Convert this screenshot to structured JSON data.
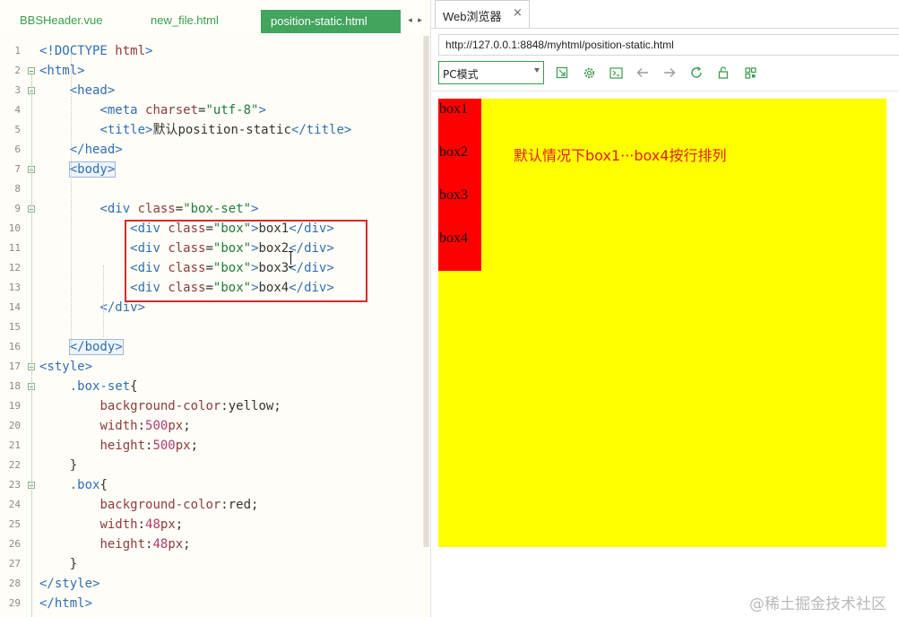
{
  "editor": {
    "tabs": [
      {
        "label": "BBSHeader.vue",
        "active": false
      },
      {
        "label": "new_file.html",
        "active": false
      },
      {
        "label": "position-static.html",
        "active": true
      }
    ],
    "tab_scroll": {
      "left": "◂",
      "right": "▸"
    },
    "lines": [
      {
        "n": "1",
        "tokens": [
          [
            "tg",
            "<!DOCTYPE "
          ],
          [
            "at",
            "html"
          ],
          [
            "tg",
            ">"
          ]
        ]
      },
      {
        "n": "2",
        "tokens": [
          [
            "tg",
            "<html>"
          ]
        ]
      },
      {
        "n": "3",
        "tokens": [
          [
            "tx",
            "    "
          ],
          [
            "tg",
            "<head>"
          ]
        ]
      },
      {
        "n": "4",
        "tokens": [
          [
            "tx",
            "        "
          ],
          [
            "tg",
            "<meta "
          ],
          [
            "at",
            "charset"
          ],
          [
            "tx",
            "="
          ],
          [
            "st",
            "\"utf-8\""
          ],
          [
            "tg",
            ">"
          ]
        ]
      },
      {
        "n": "5",
        "tokens": [
          [
            "tx",
            "        "
          ],
          [
            "tg",
            "<title>"
          ],
          [
            "tx",
            "默认position-static"
          ],
          [
            "tg",
            "</title>"
          ]
        ]
      },
      {
        "n": "6",
        "tokens": [
          [
            "tx",
            "    "
          ],
          [
            "tg",
            "</head>"
          ]
        ]
      },
      {
        "n": "7",
        "tokens": [
          [
            "tx",
            "    "
          ],
          [
            "tg",
            "<body>"
          ]
        ]
      },
      {
        "n": "8",
        "tokens": []
      },
      {
        "n": "9",
        "tokens": [
          [
            "tx",
            "        "
          ],
          [
            "tg",
            "<div "
          ],
          [
            "at",
            "class"
          ],
          [
            "tx",
            "="
          ],
          [
            "st",
            "\"box-set\""
          ],
          [
            "tg",
            ">"
          ]
        ]
      },
      {
        "n": "10",
        "tokens": [
          [
            "tx",
            "            "
          ],
          [
            "tg",
            "<div "
          ],
          [
            "at",
            "class"
          ],
          [
            "tx",
            "="
          ],
          [
            "st",
            "\"box\""
          ],
          [
            "tg",
            ">"
          ],
          [
            "tx",
            "box1"
          ],
          [
            "tg",
            "</div>"
          ]
        ]
      },
      {
        "n": "11",
        "tokens": [
          [
            "tx",
            "            "
          ],
          [
            "tg",
            "<div "
          ],
          [
            "at",
            "class"
          ],
          [
            "tx",
            "="
          ],
          [
            "st",
            "\"box\""
          ],
          [
            "tg",
            ">"
          ],
          [
            "tx",
            "box2"
          ],
          [
            "tg",
            "</div>"
          ]
        ]
      },
      {
        "n": "12",
        "tokens": [
          [
            "tx",
            "            "
          ],
          [
            "tg",
            "<div "
          ],
          [
            "at",
            "class"
          ],
          [
            "tx",
            "="
          ],
          [
            "st",
            "\"box\""
          ],
          [
            "tg",
            ">"
          ],
          [
            "tx",
            "box3"
          ],
          [
            "tg",
            "</div>"
          ]
        ]
      },
      {
        "n": "13",
        "tokens": [
          [
            "tx",
            "            "
          ],
          [
            "tg",
            "<div "
          ],
          [
            "at",
            "class"
          ],
          [
            "tx",
            "="
          ],
          [
            "st",
            "\"box\""
          ],
          [
            "tg",
            ">"
          ],
          [
            "tx",
            "box4"
          ],
          [
            "tg",
            "</div>"
          ]
        ]
      },
      {
        "n": "14",
        "tokens": [
          [
            "tx",
            "        "
          ],
          [
            "tg",
            "</div>"
          ]
        ]
      },
      {
        "n": "15",
        "tokens": []
      },
      {
        "n": "16",
        "tokens": [
          [
            "tx",
            "    "
          ],
          [
            "tg",
            "</body>"
          ]
        ]
      },
      {
        "n": "17",
        "tokens": [
          [
            "tg",
            "<style>"
          ]
        ]
      },
      {
        "n": "18",
        "tokens": [
          [
            "tx",
            "    "
          ],
          [
            "sel",
            ".box-set"
          ],
          [
            "tx",
            "{"
          ]
        ]
      },
      {
        "n": "19",
        "tokens": [
          [
            "tx",
            "        "
          ],
          [
            "pr",
            "background-color"
          ],
          [
            "tx",
            ":yellow;"
          ]
        ]
      },
      {
        "n": "20",
        "tokens": [
          [
            "tx",
            "        "
          ],
          [
            "pr",
            "width"
          ],
          [
            "tx",
            ":"
          ],
          [
            "nu",
            "500"
          ],
          [
            "un",
            "px"
          ],
          [
            "tx",
            ";"
          ]
        ]
      },
      {
        "n": "21",
        "tokens": [
          [
            "tx",
            "        "
          ],
          [
            "pr",
            "height"
          ],
          [
            "tx",
            ":"
          ],
          [
            "nu",
            "500"
          ],
          [
            "un",
            "px"
          ],
          [
            "tx",
            ";"
          ]
        ]
      },
      {
        "n": "22",
        "tokens": [
          [
            "tx",
            "    }"
          ]
        ]
      },
      {
        "n": "23",
        "tokens": [
          [
            "tx",
            "    "
          ],
          [
            "sel",
            ".box"
          ],
          [
            "tx",
            "{"
          ]
        ]
      },
      {
        "n": "24",
        "tokens": [
          [
            "tx",
            "        "
          ],
          [
            "pr",
            "background-color"
          ],
          [
            "tx",
            ":red;"
          ]
        ]
      },
      {
        "n": "25",
        "tokens": [
          [
            "tx",
            "        "
          ],
          [
            "pr",
            "width"
          ],
          [
            "tx",
            ":"
          ],
          [
            "nu",
            "48"
          ],
          [
            "un",
            "px"
          ],
          [
            "tx",
            ";"
          ]
        ]
      },
      {
        "n": "26",
        "tokens": [
          [
            "tx",
            "        "
          ],
          [
            "pr",
            "height"
          ],
          [
            "tx",
            ":"
          ],
          [
            "nu",
            "48"
          ],
          [
            "un",
            "px"
          ],
          [
            "tx",
            ";"
          ]
        ]
      },
      {
        "n": "27",
        "tokens": [
          [
            "tx",
            "    }"
          ]
        ]
      },
      {
        "n": "28",
        "tokens": [
          [
            "tg",
            "</style>"
          ]
        ]
      },
      {
        "n": "29",
        "tokens": [
          [
            "tg",
            "</html>"
          ]
        ]
      }
    ]
  },
  "browser": {
    "tab_title": "Web浏览器",
    "tab_close": "×",
    "url": "http://127.0.0.1:8848/myhtml/position-static.html",
    "mode": "PC模式",
    "toolbar_icons": [
      "open-external-icon",
      "gear-icon",
      "console-icon",
      "back-icon",
      "forward-icon",
      "refresh-icon",
      "lock-icon",
      "qrcode-icon"
    ],
    "page": {
      "boxes": [
        "box1",
        "box2",
        "box3",
        "box4"
      ],
      "note": "默认情况下box1···box4按行排列",
      "box_set_color": "#ffff00",
      "box_color": "#ff0000"
    }
  },
  "watermark": "@稀土掘金技术社区",
  "colors": {
    "accent": "#42a45d",
    "highlight_border": "#d42b2b"
  }
}
